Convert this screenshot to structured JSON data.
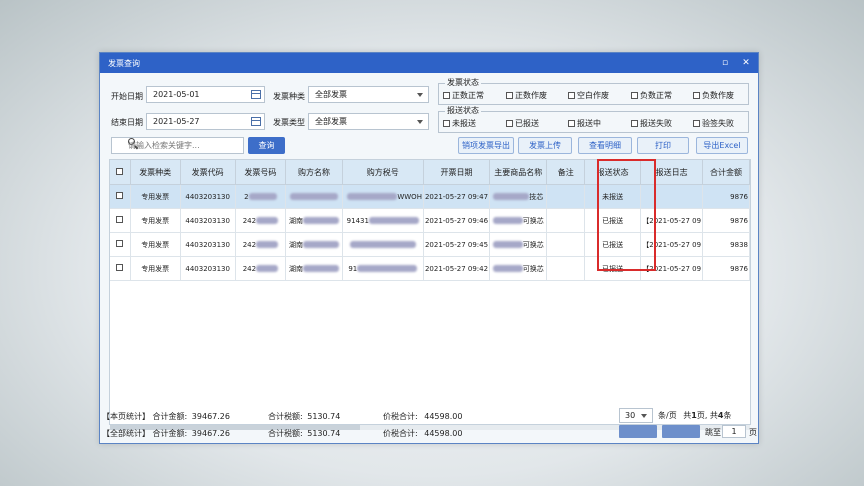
{
  "window": {
    "title": "发票查询",
    "min_icon": "minimize-icon",
    "close_icon": "close-icon"
  },
  "filters": {
    "start_date_label": "开始日期",
    "start_date": "2021-05-01",
    "end_date_label": "结束日期",
    "end_date": "2021-05-27",
    "invoice_kind_label": "发票种类",
    "invoice_kind": "全部发票",
    "invoice_type_label": "发票类型",
    "invoice_type": "全部发票",
    "invoice_status": {
      "title": "发票状态",
      "options": [
        "正数正常",
        "正数作废",
        "空白作废",
        "负数正常",
        "负数作废"
      ]
    },
    "report_status": {
      "title": "报送状态",
      "options": [
        "未报送",
        "已报送",
        "报送中",
        "报送失败",
        "验签失败"
      ]
    }
  },
  "search": {
    "placeholder": "请输入检索关键字...",
    "button": "查询"
  },
  "toolbar": {
    "export": "销项发票导出",
    "upload": "发票上传",
    "detail": "查看明细",
    "print": "打印",
    "export_excel": "导出Excel"
  },
  "table": {
    "headers": [
      "发票种类",
      "发票代码",
      "发票号码",
      "购方名称",
      "购方税号",
      "开票日期",
      "主要商品名称",
      "备注",
      "报送状态",
      "报送日志",
      "合计金额"
    ],
    "rows": [
      {
        "kind": "专用发票",
        "code": "4403203130",
        "number": "2",
        "buyer": "",
        "tax_id": "WWOH",
        "date": "2021-05-27 09:47",
        "goods": "技芯",
        "remark": "",
        "status": "未报送",
        "log": "",
        "amount": "9876"
      },
      {
        "kind": "专用发票",
        "code": "4403203130",
        "number": "242",
        "buyer": "湖南",
        "tax_id": "91431",
        "date": "2021-05-27 09:46",
        "goods": "可换芯",
        "remark": "",
        "status": "已报送",
        "log": "【2021-05-27 09",
        "amount": "9876"
      },
      {
        "kind": "专用发票",
        "code": "4403203130",
        "number": "242",
        "buyer": "湖南",
        "tax_id": "",
        "date": "2021-05-27 09:45",
        "goods": "可换芯",
        "remark": "",
        "status": "已报送",
        "log": "【2021-05-27 09",
        "amount": "9838"
      },
      {
        "kind": "专用发票",
        "code": "4403203130",
        "number": "242",
        "buyer": "湖南",
        "tax_id": "91",
        "date": "2021-05-27 09:42",
        "goods": "可换芯",
        "remark": "",
        "status": "已报送",
        "log": "【2021-05-27 09",
        "amount": "9876"
      }
    ]
  },
  "summary": {
    "page": {
      "label": "【本页统计】",
      "total_amount_label": "合计金额:",
      "total_amount": "39467.26",
      "tax_label": "合计税额:",
      "tax": "5130.74",
      "gross_label": "价税合计:",
      "gross": "44598.00"
    },
    "all": {
      "label": "【全部统计】",
      "total_amount_label": "合计金额:",
      "total_amount": "39467.26",
      "tax_label": "合计税额:",
      "tax": "5130.74",
      "gross_label": "价税合计:",
      "gross": "44598.00"
    }
  },
  "pager": {
    "page_size": "30",
    "per_page_text": "条/页",
    "total_prefix": "共",
    "total_pages": "1",
    "pages_text": "页,",
    "total_rows": "4",
    "rows_text": "条",
    "goto_label": "跳至",
    "goto_value": "1",
    "page_suffix": "页"
  }
}
